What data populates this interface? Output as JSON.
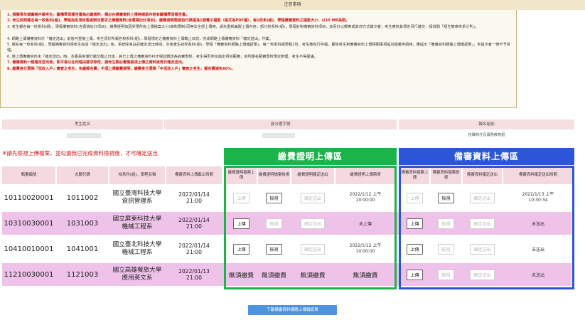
{
  "notice": {
    "title": "注意事項",
    "items": [
      {
        "text": "1. 撰擬青年儲蓄帳戶報考生，聽懂學習報告書為必繳資料，報必在備審資料上傳時確認內容有聽懂學習報告書。",
        "red": true
      },
      {
        "text": "2. 考生依照報名每一校系科(組)，學程指定項目暫處辦法要求之備審資料(含選填加分項目)，繳費證明需請自行掃描為1個電子檔案（格式為PDF檔），每1校系(組)、學程備審資料之檔案大小，以10 MB為限。",
        "red": true
      },
      {
        "text": "3. 考生報名每一校系科(組)，學程備審資料(含選填加分項目)，繳費證明如因受限所有上傳檔案大小(總和限制)而無法全部上傳時，請先重新編製上傳內容，部分校系科(組)，學程針對備審資料項目，如另訂以郵寄或其他方式繳交者，考生應依其規定另行繳交，請詳閱「招生簡章校系分則」。",
        "red": false,
        "wrap": true
      },
      {
        "text": "4. 網路上傳備審資料於「確定送出」前皆可重複上傳，考生須於所報名校系科(組)，學程規定之備審資料上傳截止日前，完成網路上傳備審資料「確定送出」作業。",
        "red": false
      },
      {
        "text": "5. 報名每一校系科(組)，學程備審資料經考生完成「確定送出」後，系統除會註記確定送出時間，亦會產生該校系科(組)，學程「備審資料網路上傳確認單」，每一校系科組學程1份，考生應自行存檔，嚴後考生對備審資料上傳相關事項提出疑義申請時，應提示「備審資料網路上傳確認單」，未提示者一律不予受理。",
        "red": false,
        "wrap": true
      },
      {
        "text": "6. 僅上傳備審資料未「確定送出」時，本委員會僅於繳交截止日後，將已上傳之備審資料PDF檔並轉送各該審學校，考生得否參加指定項目甄審，依所報名甄審學校規定辦理，考生不得異議。",
        "red": false
      },
      {
        "text": "7. 備審資料一經確定送出後，即不得以任何理由要求修改，請考生務必審慎檢視上傳之資料後再行確定送出。",
        "red": true
      },
      {
        "text": "8. 繳費身分選擇「低收入戶」審查之考生，免繳報名費，不須上傳繳費證明，繳費身分選擇「中低收入戶」審查之考生，報名費減免60%。",
        "red": true
      }
    ]
  },
  "student_info": {
    "name_header": "考生姓名",
    "id_header": "身分證字號",
    "group_header": "報名組別",
    "group_value": "技職特才及實務教育組"
  },
  "warning": "※請先檢視上傳檔案，並勾選我已完成資料檢視後，才可確定送出",
  "sections": {
    "fee": "繳費證明上傳區",
    "review": "備審資料上傳區"
  },
  "table": {
    "headers": [
      "甄審編號",
      "志願代碼",
      "校系科(組)、學程名稱",
      "備審資料上傳截止時間",
      "繳費證明檔案上傳",
      "繳費證明檔案檢視",
      "繳費證明確定送出",
      "繳費證明上傳時間",
      "備審資料檔案上傳",
      "備審資料檔案檢視",
      "備審資料確定送出",
      "備審資料確定送出時間"
    ],
    "rows": [
      {
        "id": "10110020001",
        "code": "1011002",
        "school": "國立臺灣科技大學",
        "dept": "資訊管理系",
        "deadline_date": "2022/01/14",
        "deadline_time": "21:00",
        "fee": {
          "no_fee": false,
          "upload": "上傳",
          "view": "檢視",
          "submit": "確定送出",
          "time": "2022/1/12 上午",
          "time2": "10:00:00"
        },
        "review": {
          "upload": "上傳",
          "view": "檢視",
          "submit": "確定送出",
          "time": "2022/1/13 上午",
          "time2": "10:30:34"
        }
      },
      {
        "id": "10310030001",
        "code": "1031003",
        "school": "國立屏東科技大學",
        "dept": "機械工程系",
        "deadline_date": "2022/01/14",
        "deadline_time": "21:00",
        "fee": {
          "no_fee": false,
          "upload": "上傳",
          "view": "檢視",
          "submit": "確定送出",
          "time": "未上傳",
          "time2": ""
        },
        "review": {
          "upload": "上傳",
          "view": "檢視",
          "submit": "確定送出",
          "time": "未送出",
          "time2": ""
        }
      },
      {
        "id": "10410010001",
        "code": "1041001",
        "school": "國立臺北科技大學",
        "dept": "機械工程系",
        "deadline_date": "2022/01/14",
        "deadline_time": "21:00",
        "fee": {
          "no_fee": false,
          "upload": "上傳",
          "view": "檢視",
          "submit": "確定送出",
          "time": "2022/1/12 上午",
          "time2": "10:00:00"
        },
        "review": {
          "upload": "上傳",
          "view": "檢視",
          "submit": "確定送出",
          "time": "未送出",
          "time2": ""
        }
      },
      {
        "id": "11210030001",
        "code": "1121003",
        "school": "國立高雄餐旅大學",
        "dept": "應用英文系",
        "deadline_date": "2022/01/13",
        "deadline_time": "21:00",
        "fee": {
          "no_fee": true,
          "label": "無須繳費"
        },
        "review": {
          "upload": "上傳",
          "view": "檢視",
          "submit": "確定送出",
          "time": "未送出",
          "time2": ""
        }
      }
    ]
  },
  "download_button": "下載備審資料網路上傳確認單",
  "colors": {
    "fee_green": "#1cb34a",
    "review_blue": "#2b56d8",
    "row_pink": "#efc2ea",
    "warning_red": "#d01818"
  }
}
